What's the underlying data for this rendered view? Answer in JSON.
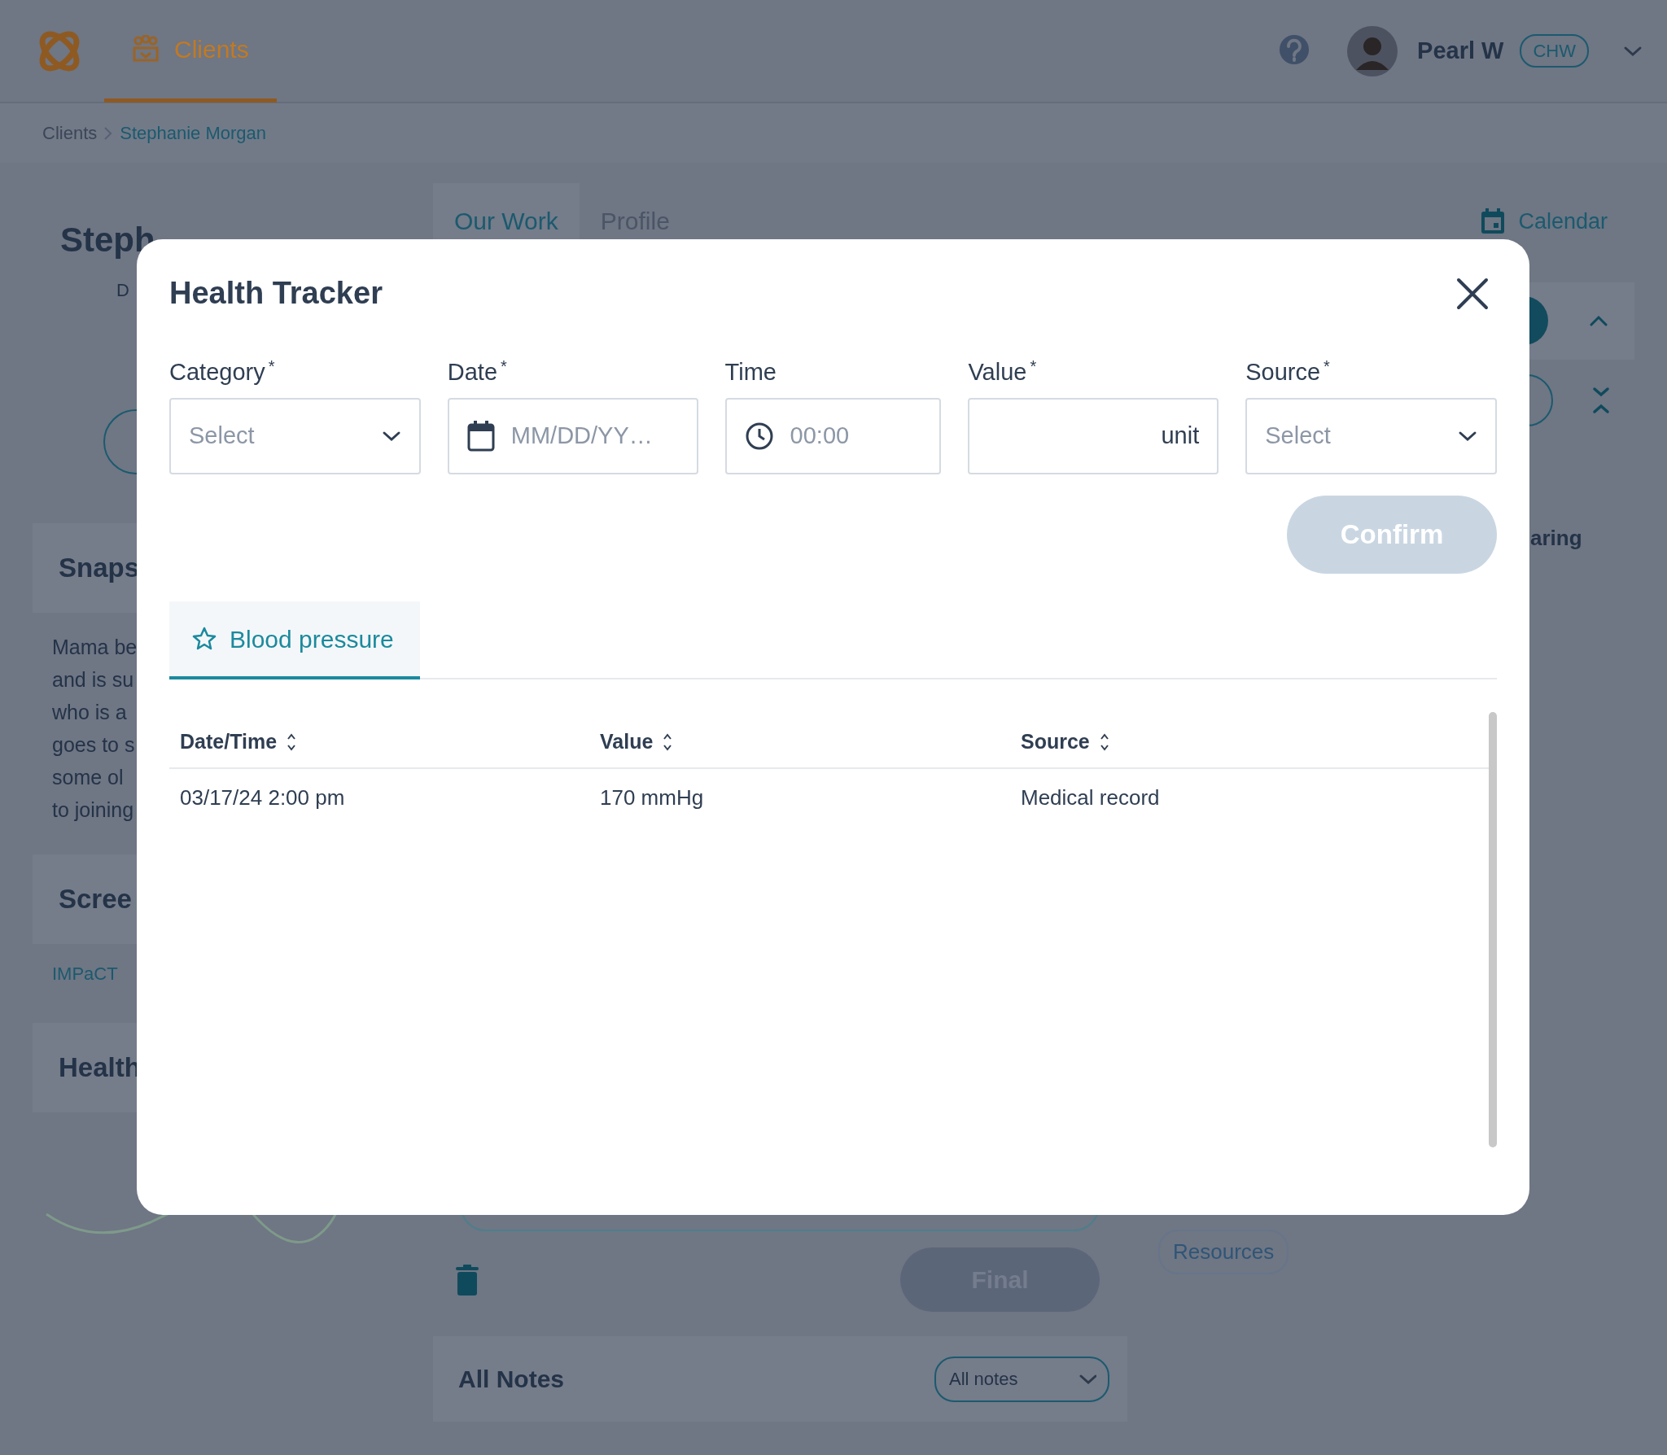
{
  "header": {
    "nav": [
      {
        "label": "Clients",
        "selected": true
      }
    ],
    "user": {
      "name": "Pearl W",
      "role": "CHW"
    }
  },
  "breadcrumb": [
    {
      "label": "Clients",
      "current": false
    },
    {
      "label": "Stephanie Morgan",
      "current": true
    }
  ],
  "client_panel": {
    "name": "Steph",
    "line_2": "D",
    "snapshot": {
      "title": "Snaps",
      "lines": [
        "Mama be",
        "and is su",
        "who is a",
        "goes to s",
        "some ol",
        "to joining"
      ]
    },
    "screening": {
      "title": "Scree",
      "link": "IMPaCT"
    },
    "health": {
      "title": "Health"
    }
  },
  "work_tabs": [
    {
      "label": "Our Work",
      "selected": true
    },
    {
      "label": "Profile",
      "selected": false
    }
  ],
  "calendar_link": "Calendar",
  "right_panel": {
    "heading": "aring",
    "tags": [
      "Resources"
    ]
  },
  "note_editor": {
    "final_button": "Final"
  },
  "all_notes": {
    "title": "All Notes",
    "filter": "All notes"
  },
  "modal": {
    "title": "Health Tracker",
    "fields": [
      {
        "kind": "select",
        "label": "Category",
        "required_mark": "*",
        "placeholder": "Select"
      },
      {
        "kind": "date",
        "label": "Date",
        "required_mark": "*",
        "placeholder": "MM/DD/YY…"
      },
      {
        "kind": "time",
        "label": "Time",
        "placeholder": "00:00"
      },
      {
        "kind": "unit",
        "label": "Value",
        "required_mark": "*",
        "unit": "unit"
      },
      {
        "kind": "select",
        "label": "Source",
        "required_mark": "*",
        "placeholder": "Select"
      }
    ],
    "confirm": {
      "label": "Confirm",
      "disabled": true
    },
    "tabs": [
      {
        "label": "Blood pressure",
        "selected": true
      }
    ],
    "table": {
      "columns": [
        "Date/Time",
        "Value",
        "Source"
      ],
      "rows": [
        [
          "03/17/24 2:00 pm",
          "170 mmHg",
          "Medical record"
        ]
      ]
    }
  }
}
